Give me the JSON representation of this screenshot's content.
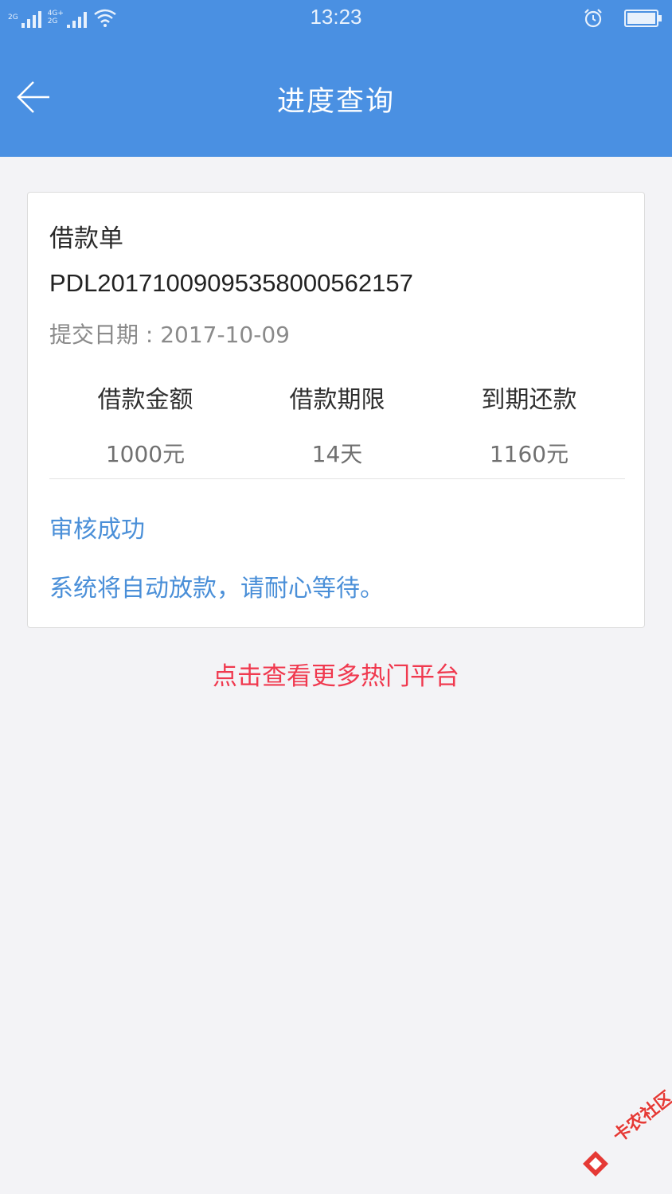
{
  "status_bar": {
    "network_1": "2G",
    "network_2_top": "4G+",
    "network_2_bottom": "2G",
    "time": "13:23",
    "icons": [
      "wifi-icon",
      "alarm-icon",
      "battery-icon"
    ]
  },
  "header": {
    "title": "进度查询",
    "back_icon": "back-arrow-icon"
  },
  "loan_card": {
    "title": "借款单",
    "order_number": "PDL20171009095358000562157",
    "submit_date": "提交日期 : 2017-10-09",
    "metrics": [
      {
        "label": "借款金额",
        "value": "1000元"
      },
      {
        "label": "借款期限",
        "value": "14天"
      },
      {
        "label": "到期还款",
        "value": "1160元"
      }
    ],
    "status": "审核成功",
    "status_message": "系统将自动放款，请耐心等待。"
  },
  "more_link": "点击查看更多热门平台",
  "watermark": "卡农社区",
  "colors": {
    "header_bg": "#4a90e2",
    "page_bg": "#f3f3f6",
    "status_blue": "#4a8fd8",
    "link_red": "#f0394f"
  }
}
